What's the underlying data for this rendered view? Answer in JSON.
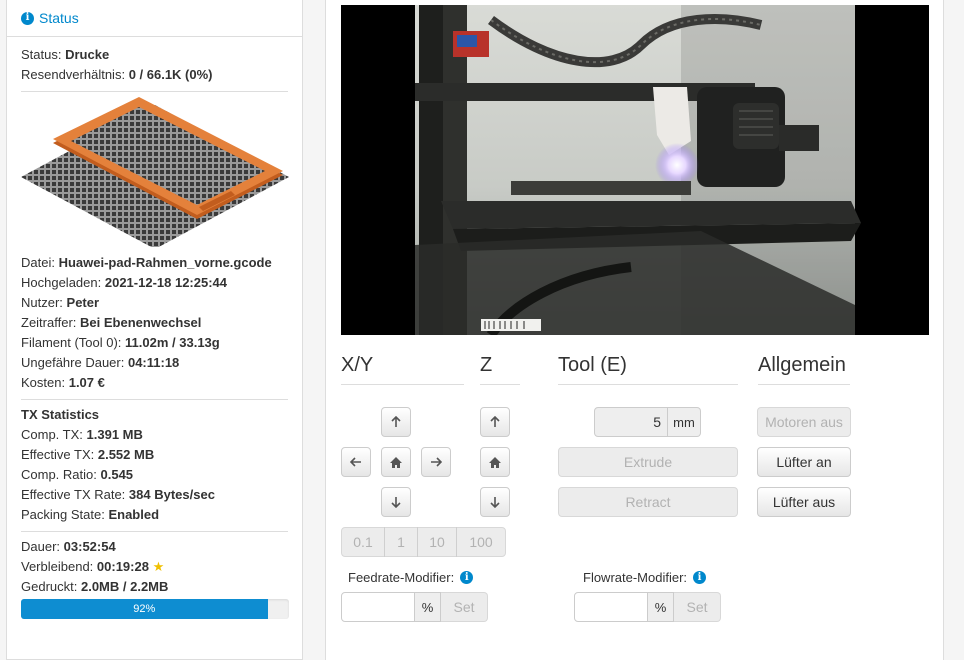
{
  "status_panel": {
    "header_title": "Status",
    "status": {
      "label": "Status:",
      "value": "Drucke"
    },
    "resend": {
      "label": "Resendverhältnis:",
      "value": "0 / 66.1K (0%)"
    },
    "file": {
      "label": "Datei:",
      "value": "Huawei-pad-Rahmen_vorne.gcode"
    },
    "uploaded": {
      "label": "Hochgeladen:",
      "value": "2021-12-18 12:25:44"
    },
    "user": {
      "label": "Nutzer:",
      "value": "Peter"
    },
    "timelapse": {
      "label": "Zeitraffer:",
      "value": "Bei Ebenenwechsel"
    },
    "filament": {
      "label": "Filament (Tool 0):",
      "value": "11.02m / 33.13g"
    },
    "est_duration": {
      "label": "Ungefähre Dauer:",
      "value": "04:11:18"
    },
    "cost": {
      "label": "Kosten:",
      "value": "1.07 €"
    },
    "tx_title": "TX Statistics",
    "comp_tx": {
      "label": "Comp. TX:",
      "value": "1.391 MB"
    },
    "effective_tx": {
      "label": "Effective TX:",
      "value": "2.552 MB"
    },
    "comp_ratio": {
      "label": "Comp. Ratio:",
      "value": "0.545"
    },
    "effective_tx_rate": {
      "label": "Effective TX Rate:",
      "value": "384 Bytes/sec"
    },
    "packing_state": {
      "label": "Packing State:",
      "value": "Enabled"
    },
    "elapsed": {
      "label": "Dauer:",
      "value": "03:52:54"
    },
    "remaining": {
      "label": "Verbleibend:",
      "value": "00:19:28"
    },
    "printed": {
      "label": "Gedruckt:",
      "value": "2.0MB / 2.2MB"
    },
    "progress": {
      "label": "92%",
      "fraction": 0.92
    }
  },
  "control": {
    "xy": {
      "title": "X/Y"
    },
    "z": {
      "title": "Z"
    },
    "tool": {
      "title": "Tool (E)",
      "amount_value": "5",
      "amount_unit": "mm",
      "extrude_label": "Extrude",
      "retract_label": "Retract"
    },
    "general": {
      "title": "Allgemein",
      "motors_off_label": "Motoren aus",
      "fan_on_label": "Lüfter an",
      "fan_off_label": "Lüfter aus"
    },
    "step_sizes": [
      "0.1",
      "1",
      "10",
      "100"
    ],
    "feedrate": {
      "label": "Feedrate-Modifier:",
      "value": "",
      "unit": "%",
      "set_label": "Set"
    },
    "flowrate": {
      "label": "Flowrate-Modifier:",
      "value": "",
      "unit": "%",
      "set_label": "Set"
    }
  },
  "colors": {
    "accent": "#0088cc",
    "progress": "#0e8dd1",
    "print_part": "#e07a2e",
    "star": "#f0c000"
  }
}
